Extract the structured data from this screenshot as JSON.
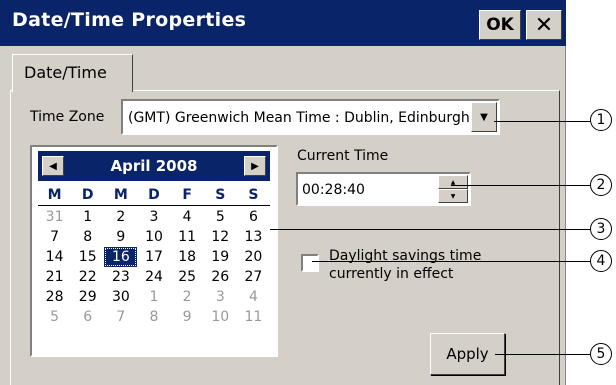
{
  "window": {
    "title": "Date/Time Properties",
    "ok_label": "OK",
    "close_label": "✕"
  },
  "tabs": [
    {
      "label": "Date/Time",
      "selected": true
    }
  ],
  "timezone": {
    "label": "Time Zone",
    "value": "(GMT) Greenwich Mean Time : Dublin, Edinburgh"
  },
  "calendar": {
    "month_label": "April 2008",
    "weekdays": [
      "M",
      "D",
      "M",
      "D",
      "F",
      "S",
      "S"
    ],
    "weeks": [
      [
        "31",
        "1",
        "2",
        "3",
        "4",
        "5",
        "6"
      ],
      [
        "7",
        "8",
        "9",
        "10",
        "11",
        "12",
        "13"
      ],
      [
        "14",
        "15",
        "16",
        "17",
        "18",
        "19",
        "20"
      ],
      [
        "21",
        "22",
        "23",
        "24",
        "25",
        "26",
        "27"
      ],
      [
        "28",
        "29",
        "30",
        "1",
        "2",
        "3",
        "4"
      ],
      [
        "5",
        "6",
        "7",
        "8",
        "9",
        "10",
        "11"
      ]
    ],
    "selected_day": "16"
  },
  "current_time": {
    "label": "Current Time",
    "value": "00:28:40"
  },
  "dst": {
    "label_line1": "Daylight savings time",
    "label_line2": "currently in effect",
    "checked": false
  },
  "apply_label": "Apply",
  "callouts": [
    "1",
    "2",
    "3",
    "4",
    "5"
  ],
  "colors": {
    "titlebar": "#0a246a",
    "face": "#d4d0c8"
  }
}
